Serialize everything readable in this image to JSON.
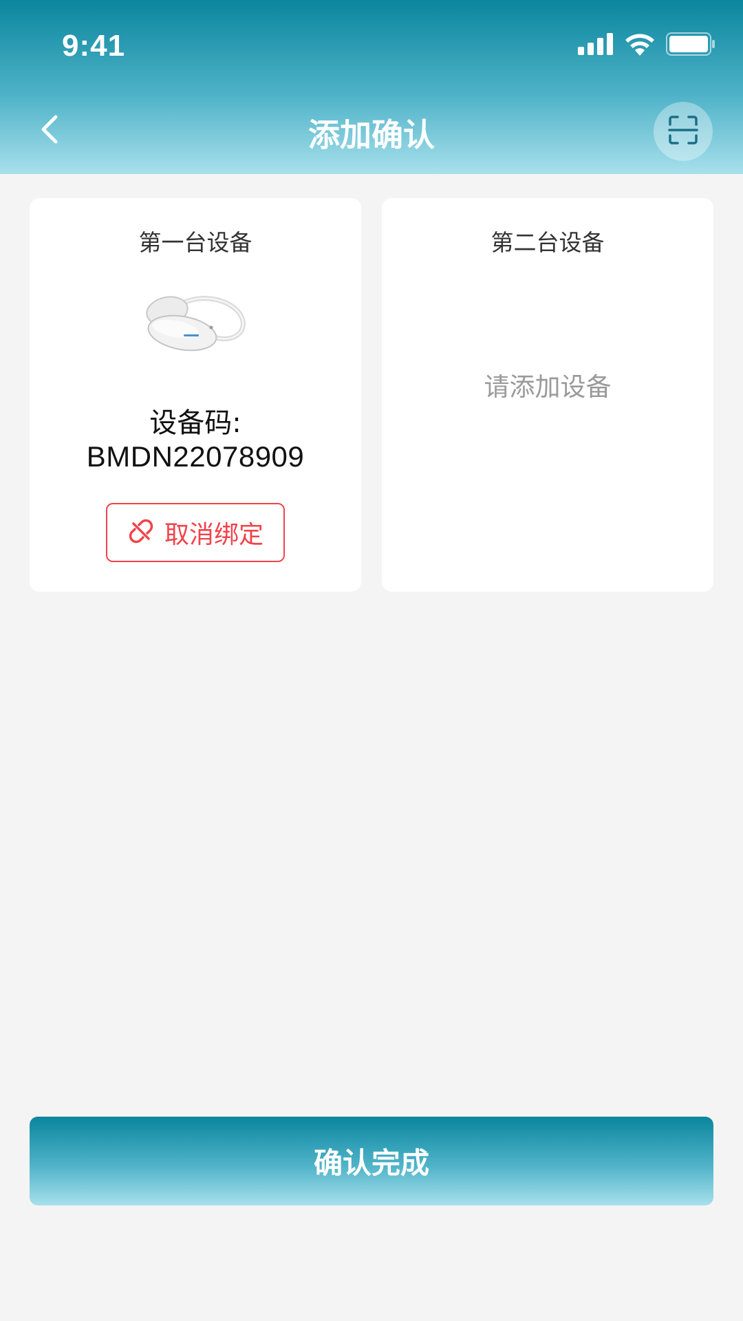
{
  "status_bar": {
    "time": "9:41",
    "icons": [
      "cellular-signal-icon",
      "wifi-icon",
      "battery-icon"
    ]
  },
  "nav": {
    "title": "添加确认",
    "back_icon": "chevron-left-icon",
    "scan_icon": "scan-icon"
  },
  "devices": [
    {
      "title": "第一台设备",
      "image": "earphone-device-image",
      "code_label": "设备码:",
      "code_value": "BMDN22078909",
      "unbind_label": "取消绑定",
      "unbind_icon": "unlink-icon"
    },
    {
      "title": "第二台设备",
      "empty_hint": "请添加设备"
    }
  ],
  "confirm_button": {
    "label": "确认完成"
  },
  "colors": {
    "header_gradient_top": "#0a869e",
    "header_gradient_bottom": "#a8e0ec",
    "danger": "#f0434b",
    "background": "#f4f4f4"
  }
}
